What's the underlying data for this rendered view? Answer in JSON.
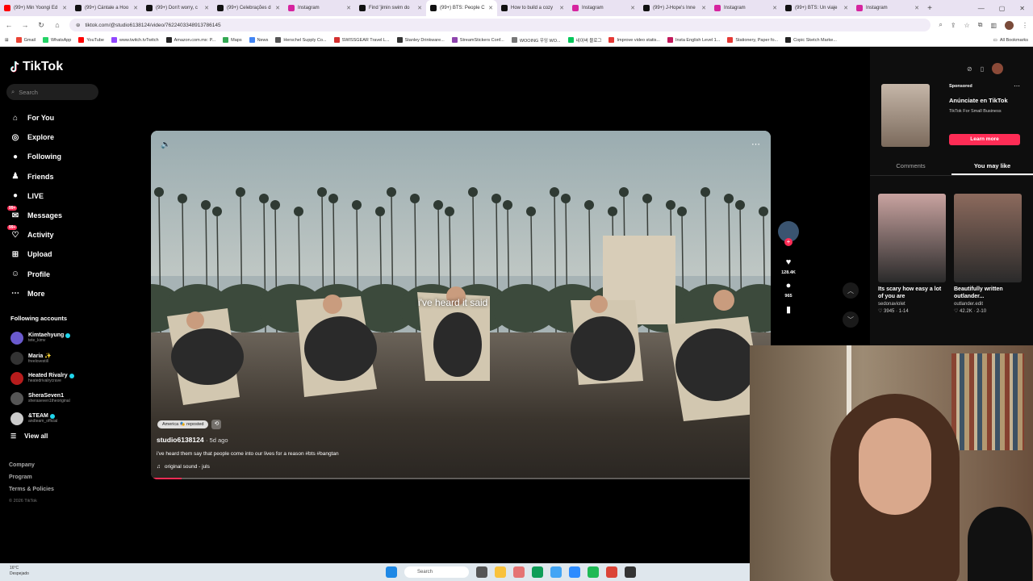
{
  "browser": {
    "tabs": [
      {
        "title": "(99+) Min Yoongi Ed",
        "color": "#ff0000"
      },
      {
        "title": "(99+) Cántale a Hoo",
        "color": "#111111"
      },
      {
        "title": "(99+) Don't worry, c",
        "color": "#111111"
      },
      {
        "title": "(99+) Celebrações d",
        "color": "#111111"
      },
      {
        "title": "Instagram",
        "color": "#d6249f"
      },
      {
        "title": "Find 'jimin swim do",
        "color": "#111111"
      },
      {
        "title": "(99+) BTS: People C",
        "color": "#111111",
        "active": true
      },
      {
        "title": "How to build a cozy",
        "color": "#111111"
      },
      {
        "title": "Instagram",
        "color": "#d6249f"
      },
      {
        "title": "(99+) J-Hope's Inne",
        "color": "#111111"
      },
      {
        "title": "Instagram",
        "color": "#d6249f"
      },
      {
        "title": "(99+) BTS: Un viaje",
        "color": "#111111"
      },
      {
        "title": "Instagram",
        "color": "#d6249f"
      }
    ],
    "url": "tiktok.com/@studio6138124/video/7622403348913786145",
    "bookmarks": [
      {
        "label": "Gmail",
        "color": "#ea4335"
      },
      {
        "label": "WhatsApp",
        "color": "#25d366"
      },
      {
        "label": "YouTube",
        "color": "#ff0000"
      },
      {
        "label": "www.twitch.tvTwitch",
        "color": "#9146ff"
      },
      {
        "label": "Amazon.com.mx: P...",
        "color": "#222222"
      },
      {
        "label": "Maps",
        "color": "#34a853"
      },
      {
        "label": "News",
        "color": "#4285f4"
      },
      {
        "label": "Herschel Supply Co...",
        "color": "#555555"
      },
      {
        "label": "SWISSGEAR Travel L...",
        "color": "#d32f2f"
      },
      {
        "label": "Stanley Drinkware...",
        "color": "#333333"
      },
      {
        "label": "StreamStickers Conf...",
        "color": "#8e44ad"
      },
      {
        "label": "WOOING 우잉 WO...",
        "color": "#777777"
      },
      {
        "label": "네이버 블로그",
        "color": "#03c75a"
      },
      {
        "label": "Improve video statis...",
        "color": "#e53935"
      },
      {
        "label": "Insta English Level 1...",
        "color": "#c2185b"
      },
      {
        "label": "Stationery, Paper fo...",
        "color": "#e53935"
      },
      {
        "label": "Copic Sketch Marke...",
        "color": "#222222"
      }
    ],
    "all_bookmarks": "All Bookmarks"
  },
  "tiktok": {
    "logo": "TikTok",
    "search_placeholder": "Search",
    "nav": [
      {
        "label": "For You",
        "icon": "home-icon",
        "glyph": "⌂"
      },
      {
        "label": "Explore",
        "icon": "compass-icon",
        "glyph": "◎"
      },
      {
        "label": "Following",
        "icon": "following-avatar-icon",
        "glyph": "●"
      },
      {
        "label": "Friends",
        "icon": "friends-icon",
        "glyph": "♟"
      },
      {
        "label": "LIVE",
        "icon": "live-avatar-icon",
        "glyph": "●"
      },
      {
        "label": "Messages",
        "icon": "messages-icon",
        "glyph": "✉",
        "badge": "99+"
      },
      {
        "label": "Activity",
        "icon": "activity-icon",
        "glyph": "♡",
        "badge": "99+"
      },
      {
        "label": "Upload",
        "icon": "upload-icon",
        "glyph": "⊞"
      },
      {
        "label": "Profile",
        "icon": "profile-icon",
        "glyph": "☺"
      },
      {
        "label": "More",
        "icon": "more-icon",
        "glyph": "⋯"
      }
    ],
    "following_title": "Following accounts",
    "following": [
      {
        "name": "Kimtaehyung",
        "handle": "tete_kimv",
        "verified": true,
        "color": "#6a5acd"
      },
      {
        "name": "Maria ✨",
        "handle": "freelovestill",
        "verified": false,
        "color": "#333333"
      },
      {
        "name": "Heated Rivalry",
        "handle": "heatedrivalrycrave",
        "verified": true,
        "color": "#b71c1c"
      },
      {
        "name": "SheraSeven1",
        "handle": "sheraseven1theoriginal",
        "verified": false,
        "color": "#555555"
      },
      {
        "name": "&TEAM",
        "handle": "andteam_official",
        "verified": true,
        "color": "#cccccc"
      }
    ],
    "view_all": "View all",
    "footer": [
      "Company",
      "Program",
      "Terms & Policies"
    ],
    "copyright": "© 2026 TikTok"
  },
  "video": {
    "overlay_caption": "i've heard it said",
    "repost_label": "America 🎭 reposted",
    "author": "studio6138124",
    "ago": "5d ago",
    "description": "i've heard them say that people come into our lives for a reason #bts #bangtan",
    "sound": "original sound - juls",
    "progress": 0.05,
    "likes": "128.4K",
    "comments": "965"
  },
  "right_panel": {
    "sponsored": "Sponsored",
    "ad_title": "Anúnciate en TikTok",
    "ad_sub": "TikTok For Small Business",
    "learn_more": "Learn more",
    "tabs": [
      "Comments",
      "You may like"
    ],
    "active_tab": 1,
    "cards": [
      {
        "title": "Its scary how easy a lot of you are",
        "user": "sedonaviolet",
        "meta": "♡ 3945 · 1-14",
        "color": "#c9a3a0"
      },
      {
        "title": "Beautifully written outlander...",
        "user": "outlander.edit",
        "meta": "♡ 42.2K · 2-10",
        "color": "#8c6a5d"
      }
    ]
  },
  "taskbar": {
    "weather_temp": "16°C",
    "weather_desc": "Despejado",
    "search": "Search"
  }
}
